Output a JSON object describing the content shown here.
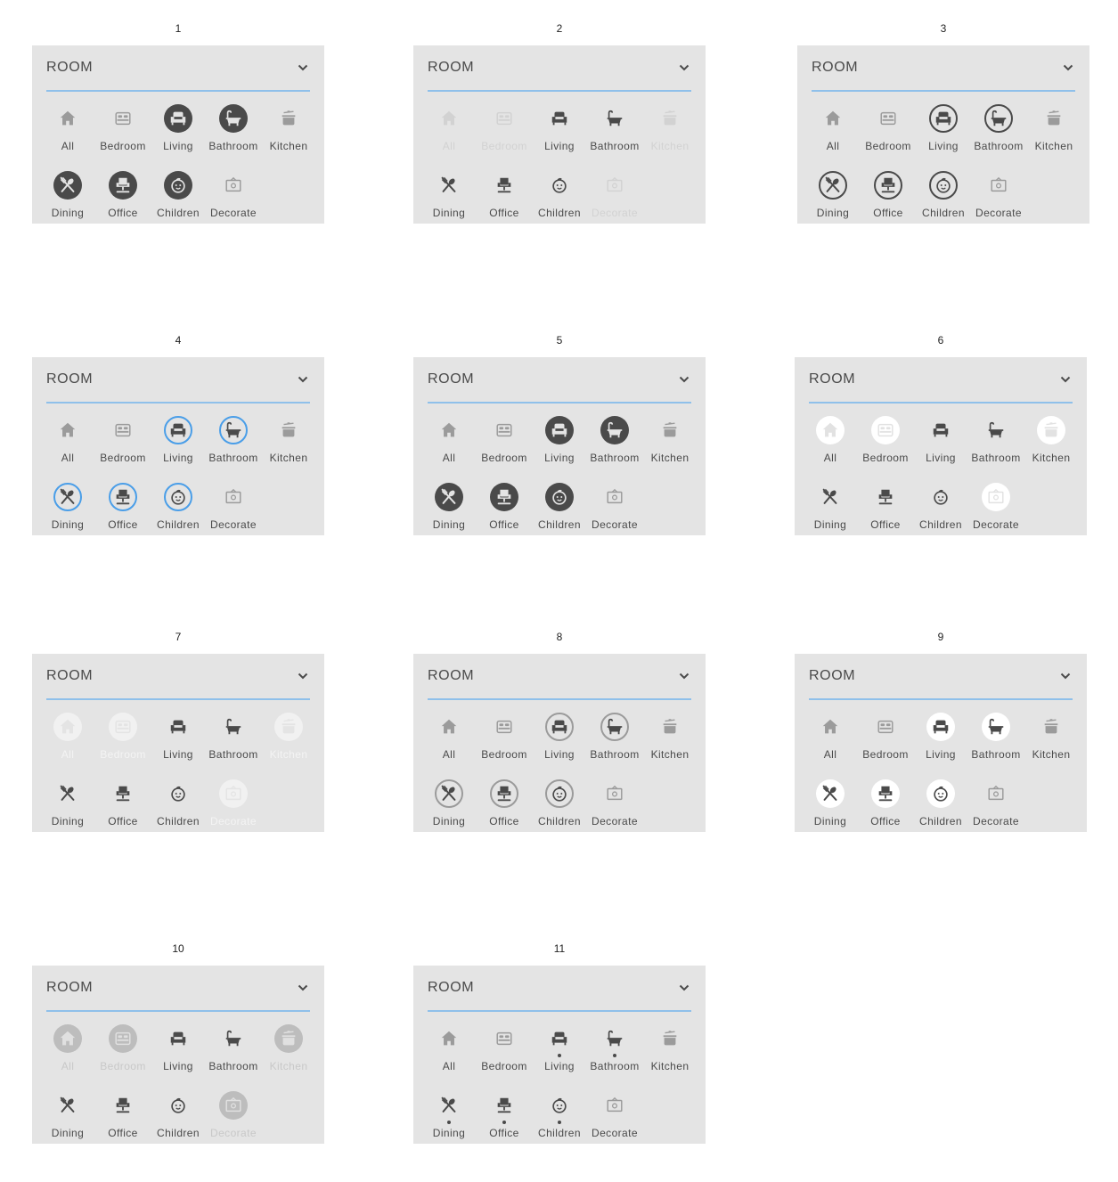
{
  "panel_title": "ROOM",
  "colors": {
    "panel_bg": "#e4e4e4",
    "text_dark": "#4a4a4a",
    "icon_muted": "#9b9b9b",
    "icon_faint": "#d2d2d2",
    "accent_blue": "#4a9ee8",
    "underline": "#8fc0ea"
  },
  "categories": [
    {
      "key": "all",
      "label": "All",
      "icon": "home-icon"
    },
    {
      "key": "bedroom",
      "label": "Bedroom",
      "icon": "bed-icon"
    },
    {
      "key": "living",
      "label": "Living",
      "icon": "armchair-icon"
    },
    {
      "key": "bathroom",
      "label": "Bathroom",
      "icon": "bathtub-icon"
    },
    {
      "key": "kitchen",
      "label": "Kitchen",
      "icon": "cooking-pot-icon"
    },
    {
      "key": "dining",
      "label": "Dining",
      "icon": "fork-spoon-icon"
    },
    {
      "key": "office",
      "label": "Office",
      "icon": "office-chair-icon"
    },
    {
      "key": "children",
      "label": "Children",
      "icon": "baby-face-icon"
    },
    {
      "key": "decorate",
      "label": "Decorate",
      "icon": "picture-frame-icon"
    }
  ],
  "variants": [
    {
      "number": "1",
      "active_style": "filled-dark",
      "inactive_style": "muted",
      "active": [
        "living",
        "bathroom",
        "dining",
        "office",
        "children"
      ]
    },
    {
      "number": "2",
      "active_style": "plain",
      "inactive_style": "faint",
      "active": [
        "living",
        "bathroom",
        "dining",
        "office",
        "children"
      ]
    },
    {
      "number": "3",
      "active_style": "outline-dark",
      "inactive_style": "muted",
      "active": [
        "living",
        "bathroom",
        "dining",
        "office",
        "children"
      ]
    },
    {
      "number": "4",
      "active_style": "outline-blue",
      "inactive_style": "muted",
      "active": [
        "living",
        "bathroom",
        "dining",
        "office",
        "children"
      ]
    },
    {
      "number": "5",
      "active_style": "filled-dark",
      "inactive_style": "muted",
      "active": [
        "living",
        "bathroom",
        "dining",
        "office",
        "children"
      ]
    },
    {
      "number": "6",
      "active_style": "plain",
      "inactive_style": "white-circle",
      "active": [
        "living",
        "bathroom",
        "dining",
        "office",
        "children"
      ]
    },
    {
      "number": "7",
      "active_style": "plain",
      "inactive_style": "white-circle-faded",
      "active": [
        "living",
        "bathroom",
        "dining",
        "office",
        "children"
      ]
    },
    {
      "number": "8",
      "active_style": "outline-gray",
      "inactive_style": "muted",
      "active": [
        "living",
        "bathroom",
        "dining",
        "office",
        "children"
      ]
    },
    {
      "number": "9",
      "active_style": "white-circle",
      "inactive_style": "muted",
      "active": [
        "living",
        "bathroom",
        "dining",
        "office",
        "children"
      ]
    },
    {
      "number": "10",
      "active_style": "plain",
      "inactive_style": "gray-circle",
      "active": [
        "living",
        "bathroom",
        "dining",
        "office",
        "children"
      ]
    },
    {
      "number": "11",
      "active_style": "dot",
      "inactive_style": "muted",
      "active": [
        "living",
        "bathroom",
        "dining",
        "office",
        "children"
      ]
    }
  ]
}
